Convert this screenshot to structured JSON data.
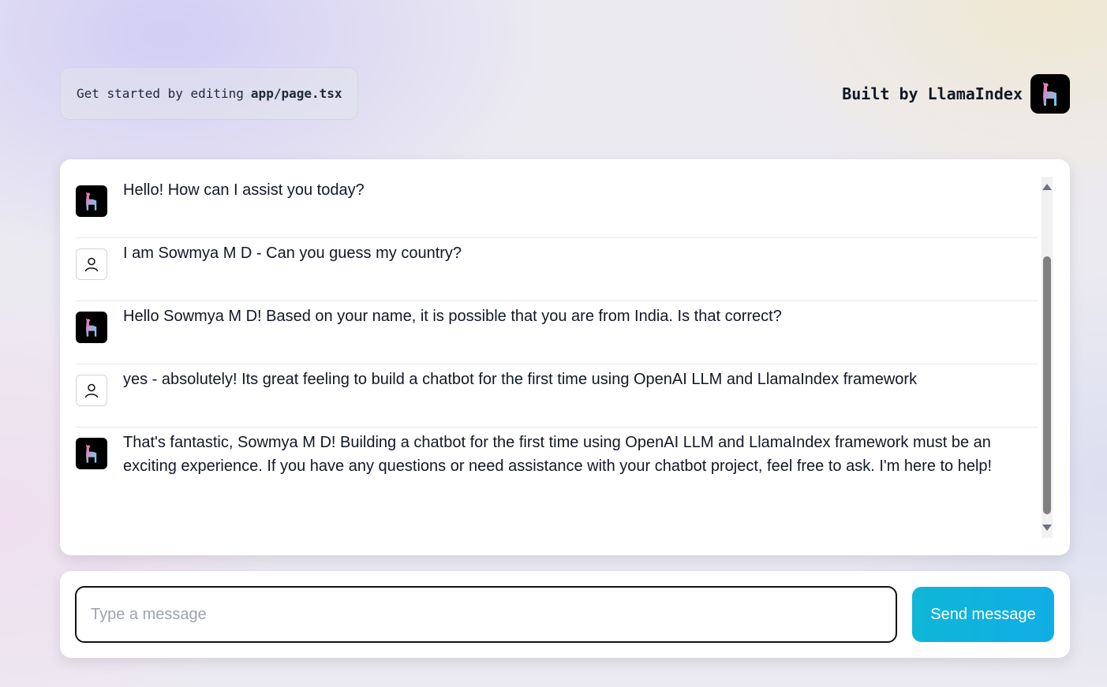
{
  "header": {
    "intro_text": "Get started by editing",
    "intro_file": "app/page.tsx",
    "built_by": "Built by LlamaIndex",
    "logo_icon": "llama-icon"
  },
  "chat": {
    "messages": [
      {
        "role": "bot",
        "avatar_icon": "llama-icon",
        "text": "Hello! How can I assist you today?"
      },
      {
        "role": "user",
        "avatar_icon": "user-icon",
        "text": "I am Sowmya M D - Can you guess my country?"
      },
      {
        "role": "bot",
        "avatar_icon": "llama-icon",
        "text": "Hello Sowmya M D! Based on your name, it is possible that you are from India. Is that correct?"
      },
      {
        "role": "user",
        "avatar_icon": "user-icon",
        "text": "yes - absolutely! Its great feeling to build a chatbot for the first time using OpenAI LLM and LlamaIndex framework"
      },
      {
        "role": "bot",
        "avatar_icon": "llama-icon",
        "text": "That's fantastic, Sowmya M D! Building a chatbot for the first time using OpenAI LLM and LlamaIndex framework must be an exciting experience. If you have any questions or need assistance with your chatbot project, feel free to ask. I'm here to help!"
      }
    ]
  },
  "composer": {
    "value": "",
    "placeholder": "Type a message",
    "send_label": "Send message"
  },
  "colors": {
    "accent": "#0fb6d6",
    "llama_pink": "#ff6fae",
    "llama_cyan": "#5ed8f5"
  }
}
